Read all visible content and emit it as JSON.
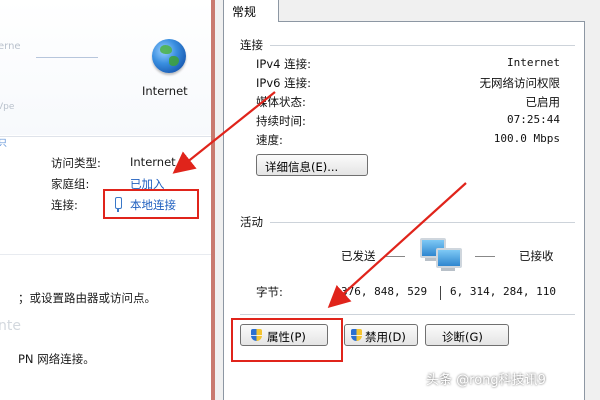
{
  "left_panel": {
    "ghost_texts": [
      "erne",
      "Vpe",
      "只",
      "nte"
    ],
    "internet_label": "Internet",
    "access_type_label": "访问类型:",
    "access_type_value": "Internet",
    "homegroup_label": "家庭组:",
    "homegroup_value": "已加入",
    "connection_label": "连接:",
    "connection_value": "本地连接",
    "task_text_1": "；或设置路由器或访问点。",
    "task_text_2": "PN 网络连接。"
  },
  "dialog": {
    "tab_general": "常规",
    "connection_section": "连接",
    "rows": [
      {
        "label": "IPv4 连接:",
        "value": "Internet"
      },
      {
        "label": "IPv6 连接:",
        "value": "无网络访问权限"
      },
      {
        "label": "媒体状态:",
        "value": "已启用"
      },
      {
        "label": "持续时间:",
        "value": "07:25:44"
      },
      {
        "label": "速度:",
        "value": "100.0 Mbps"
      }
    ],
    "details_button": "详细信息(E)...",
    "activity_section": "活动",
    "sent_label": "已发送",
    "received_label": "已接收",
    "bytes_label": "字节:",
    "bytes_sent": "376, 848, 529",
    "bytes_received": "6, 314, 284, 110",
    "properties_button": "属性(P)",
    "disable_button": "禁用(D)",
    "diagnose_button": "诊断(G)"
  },
  "watermark": "头条 @rong科技讯9",
  "colors": {
    "annotation_red": "#e0241b",
    "link_blue": "#1f5fbf",
    "dialog_bg": "#f0f0f0"
  },
  "icons": [
    "globe-icon",
    "network-plug-icon",
    "network-computers-icon",
    "uac-shield-icon"
  ]
}
